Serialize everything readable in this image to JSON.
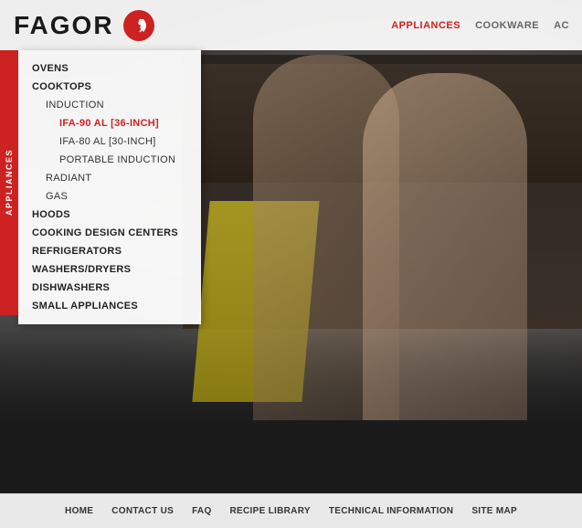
{
  "header": {
    "logo_text": "FAGOR",
    "top_nav": [
      {
        "label": "APPLIANCES",
        "active": true
      },
      {
        "label": "COOKWARE",
        "active": false
      },
      {
        "label": "AC",
        "active": false
      }
    ]
  },
  "vertical_label": "APPLIANCES",
  "menu": {
    "items": [
      {
        "label": "OVENS",
        "level": 0,
        "active": false
      },
      {
        "label": "COOKTOPS",
        "level": 0,
        "active": false
      },
      {
        "label": "INDUCTION",
        "level": 1,
        "active": false
      },
      {
        "label": "IFA-90 AL [36-INCH]",
        "level": 2,
        "active": true
      },
      {
        "label": "IFA-80 AL [30-INCH]",
        "level": 2,
        "active": false
      },
      {
        "label": "PORTABLE INDUCTION",
        "level": 2,
        "active": false
      },
      {
        "label": "RADIANT",
        "level": 1,
        "active": false
      },
      {
        "label": "GAS",
        "level": 1,
        "active": false
      },
      {
        "label": "HOODS",
        "level": 0,
        "active": false
      },
      {
        "label": "COOKING DESIGN CENTERS",
        "level": 0,
        "active": false
      },
      {
        "label": "REFRIGERATORS",
        "level": 0,
        "active": false
      },
      {
        "label": "WASHERS/DRYERS",
        "level": 0,
        "active": false
      },
      {
        "label": "DISHWASHERS",
        "level": 0,
        "active": false
      },
      {
        "label": "SMALL APPLIANCES",
        "level": 0,
        "active": false
      }
    ]
  },
  "footer": {
    "links": [
      {
        "label": "HOME"
      },
      {
        "label": "CONTACT US"
      },
      {
        "label": "FAQ"
      },
      {
        "label": "RECIPE LIBRARY"
      },
      {
        "label": "TECHNICAL INFORMATION"
      },
      {
        "label": "SITE MAP"
      }
    ]
  },
  "colors": {
    "accent": "#cc2222",
    "menu_bg": "rgba(255,255,255,0.95)",
    "header_bg": "rgba(255,255,255,0.92)"
  }
}
